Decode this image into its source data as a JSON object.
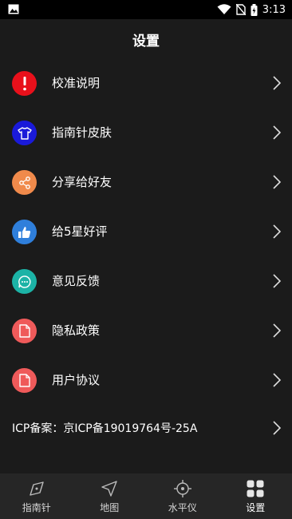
{
  "status_bar": {
    "time": "3:13"
  },
  "header": {
    "title": "设置"
  },
  "menu": {
    "items": [
      {
        "label": "校准说明",
        "icon": "exclamation-icon",
        "color": "#e8101b"
      },
      {
        "label": "指南针皮肤",
        "icon": "shirt-icon",
        "color": "#1a1ad9"
      },
      {
        "label": "分享给好友",
        "icon": "share-icon",
        "color": "#f08a4b"
      },
      {
        "label": "给5星好评",
        "icon": "thumbs-up-icon",
        "color": "#2f7fdb"
      },
      {
        "label": "意见反馈",
        "icon": "chat-icon",
        "color": "#1cb3a6"
      },
      {
        "label": "隐私政策",
        "icon": "document-icon",
        "color": "#ef5a5a"
      },
      {
        "label": "用户协议",
        "icon": "document-icon",
        "color": "#ef5a5a"
      }
    ]
  },
  "icp": {
    "label": "ICP备案：京ICP备19019764号-25A"
  },
  "tabbar": {
    "tabs": [
      {
        "label": "指南针",
        "icon": "compass-icon"
      },
      {
        "label": "地图",
        "icon": "navigation-arrow-icon"
      },
      {
        "label": "水平仪",
        "icon": "crosshair-icon"
      },
      {
        "label": "设置",
        "icon": "grid-icon",
        "active": true
      }
    ]
  }
}
